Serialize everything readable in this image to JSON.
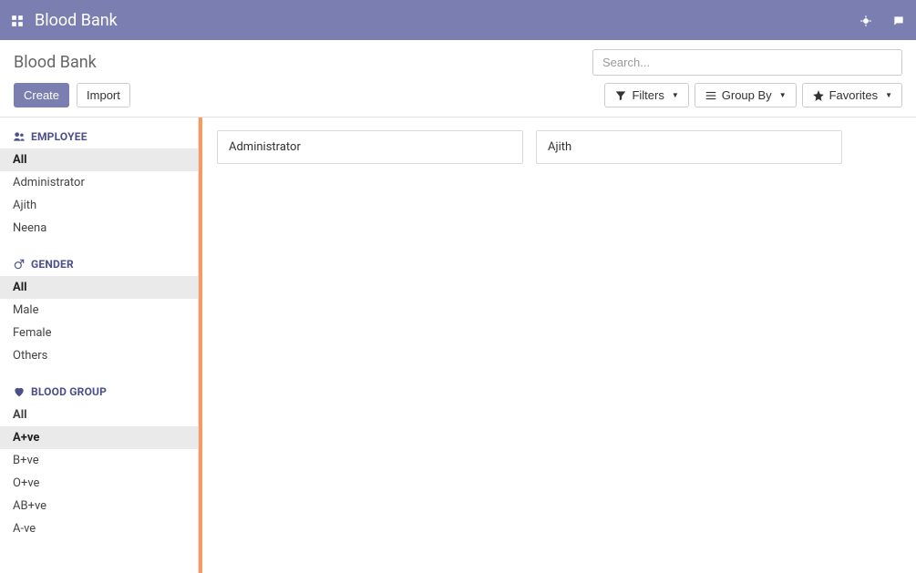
{
  "topbar": {
    "app_title": "Blood Bank"
  },
  "page": {
    "title": "Blood Bank",
    "create_label": "Create",
    "import_label": "Import"
  },
  "search": {
    "placeholder": "Search..."
  },
  "toolbar": {
    "filters_label": "Filters",
    "groupby_label": "Group By",
    "favorites_label": "Favorites"
  },
  "sidebar": {
    "sections": [
      {
        "key": "employee",
        "title": "EMPLOYEE",
        "icon": "users-icon",
        "items": [
          {
            "label": "All",
            "active": true
          },
          {
            "label": "Administrator"
          },
          {
            "label": "Ajith"
          },
          {
            "label": "Neena"
          }
        ]
      },
      {
        "key": "gender",
        "title": "GENDER",
        "icon": "male-icon",
        "items": [
          {
            "label": "All",
            "active": true
          },
          {
            "label": "Male"
          },
          {
            "label": "Female"
          },
          {
            "label": "Others"
          }
        ]
      },
      {
        "key": "bloodgroup",
        "title": "BLOOD GROUP",
        "icon": "heart-icon",
        "items": [
          {
            "label": "All",
            "bold": true
          },
          {
            "label": "A+ve",
            "active": true
          },
          {
            "label": "B+ve"
          },
          {
            "label": "O+ve"
          },
          {
            "label": "AB+ve"
          },
          {
            "label": "A-ve"
          }
        ]
      }
    ]
  },
  "records": [
    {
      "name": "Administrator"
    },
    {
      "name": "Ajith"
    }
  ],
  "icons": {
    "apps": "apps-icon",
    "bug": "bug-icon",
    "chat": "chat-icon"
  }
}
